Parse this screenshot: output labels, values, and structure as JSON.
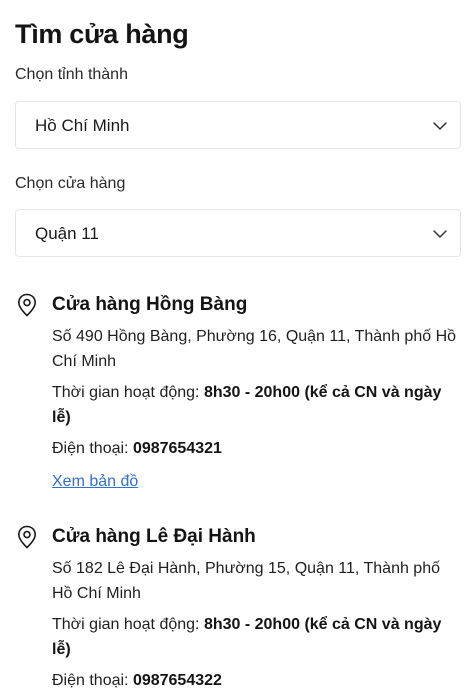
{
  "page": {
    "title": "Tìm cửa hàng"
  },
  "province": {
    "label": "Chọn tỉnh thành",
    "selected": "Hồ Chí Minh"
  },
  "store_select": {
    "label": "Chọn cửa hàng",
    "selected": "Quận 11"
  },
  "stores": [
    {
      "name": "Cửa hàng Hồng Bàng",
      "address": "Số 490 Hồng Bàng, Phường 16, Quận 11, Thành phố Hồ Chí Minh",
      "hours_label": "Thời gian hoạt động: ",
      "hours_value": "8h30 - 20h00 (kể cả CN và ngày lễ)",
      "phone_label": "Điện thoại: ",
      "phone_value": "0987654321",
      "map_link": "Xem bản đồ"
    },
    {
      "name": "Cửa hàng Lê Đại Hành",
      "address": "Số 182 Lê Đại Hành, Phường 15, Quận 11, Thành phố Hồ Chí Minh",
      "hours_label": "Thời gian hoạt động: ",
      "hours_value": "8h30 - 20h00 (kể cả CN và ngày lễ)",
      "phone_label": "Điện thoại: ",
      "phone_value": "0987654322"
    }
  ],
  "icons": {
    "store_pin": "map-pin-icon",
    "dropdown": "chevron-down-icon"
  },
  "colors": {
    "link": "#2f6fd6",
    "border": "#e6e6e6",
    "text": "#1a1a1a"
  }
}
